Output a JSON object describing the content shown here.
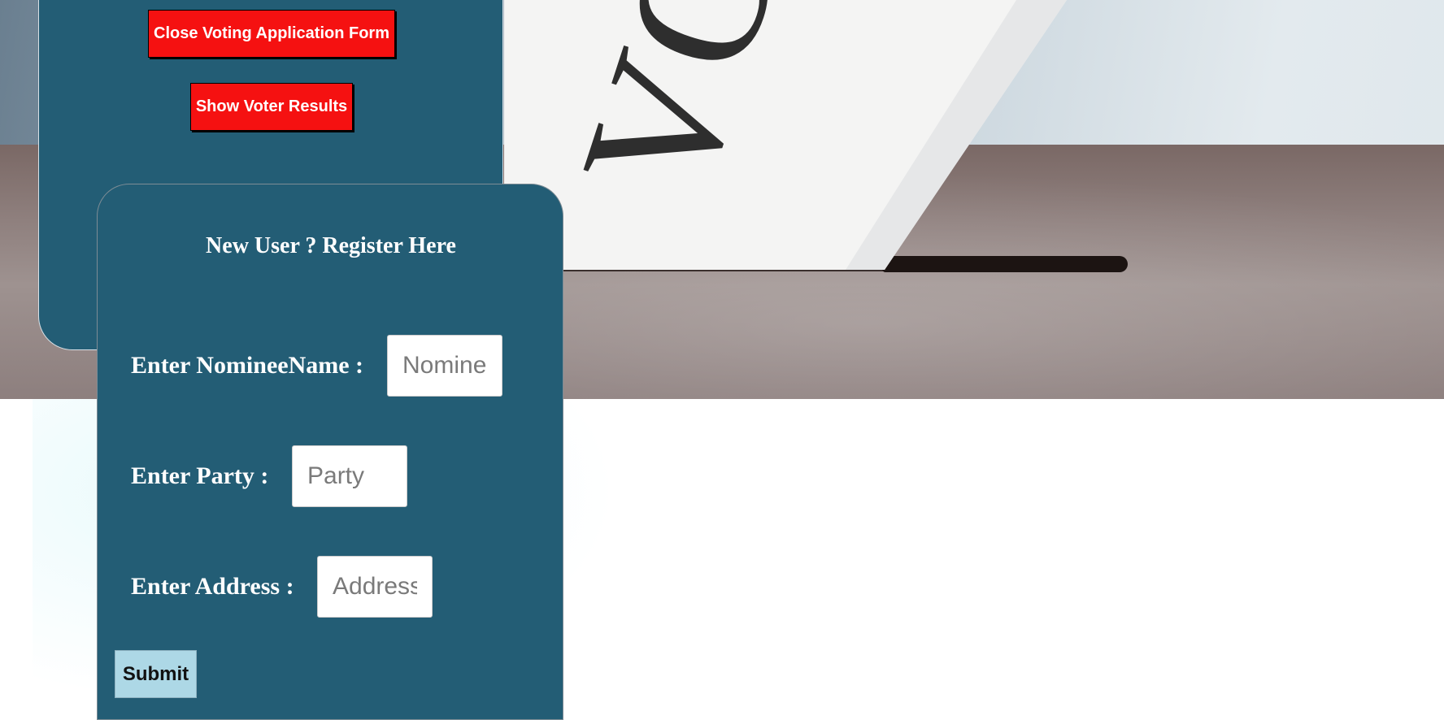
{
  "hero": {
    "ballot_text": "VOTE",
    "colors": {
      "panel": "#235d75",
      "button_red": "#f51111",
      "submit": "#add8e6"
    }
  },
  "admin_panel": {
    "close_form_label": "Close Voting Application Form",
    "show_results_label": "Show Voter Results"
  },
  "register_form": {
    "title": "New User ? Register Here",
    "fields": [
      {
        "label": "Enter NomineeName :",
        "placeholder": "NomineeName",
        "value": ""
      },
      {
        "label": "Enter Party :",
        "placeholder": "Party",
        "value": ""
      },
      {
        "label": "Enter Address :",
        "placeholder": "Address",
        "value": ""
      }
    ],
    "submit_label": "Submit"
  }
}
